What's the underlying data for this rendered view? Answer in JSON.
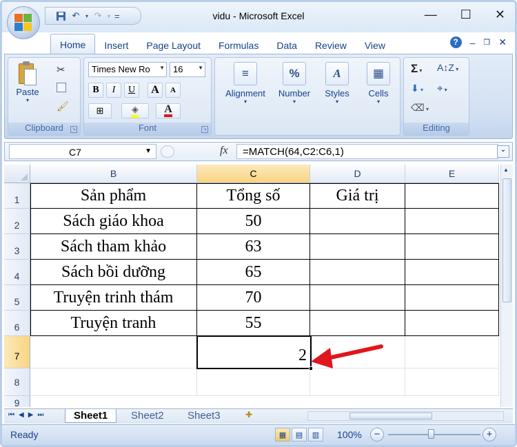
{
  "window": {
    "title": "vidu - Microsoft Excel",
    "minimize": "—",
    "maximize": "☐",
    "close": "✕"
  },
  "qat": {
    "save_icon": "save-icon",
    "undo_icon": "undo-icon",
    "redo_icon": "redo-icon",
    "customize": "="
  },
  "tabs": [
    "Home",
    "Insert",
    "Page Layout",
    "Formulas",
    "Data",
    "Review",
    "View"
  ],
  "active_tab": "Home",
  "ribbon": {
    "clipboard": {
      "label": "Clipboard",
      "paste": "Paste"
    },
    "font": {
      "label": "Font",
      "name": "Times New Ro",
      "size": "16",
      "bold": "B",
      "italic": "I",
      "underline": "U",
      "grow": "A",
      "shrink": "A",
      "color": "A"
    },
    "alignment": {
      "label": "Alignment"
    },
    "number": {
      "label": "Number",
      "icon": "%"
    },
    "styles": {
      "label": "Styles"
    },
    "cells": {
      "label": "Cells"
    },
    "editing": {
      "label": "Editing",
      "sum": "Σ"
    }
  },
  "formula_bar": {
    "name_box": "C7",
    "fx": "fx",
    "formula": "=MATCH(64,C2:C6,1)"
  },
  "grid": {
    "columns": [
      "B",
      "C",
      "D",
      "E"
    ],
    "rows": [
      "1",
      "2",
      "3",
      "4",
      "5",
      "6",
      "7",
      "8",
      "9"
    ],
    "selected_cell": "C7",
    "headers": [
      "Sản phẩm",
      "Tổng số",
      "Giá trị"
    ],
    "data": [
      {
        "product": "Sách giáo khoa",
        "total": "50"
      },
      {
        "product": "Sách tham khảo",
        "total": "63"
      },
      {
        "product": "Sách bồi dưỡng",
        "total": "65"
      },
      {
        "product": "Truyện trinh thám",
        "total": "70"
      },
      {
        "product": "Truyện tranh",
        "total": "55"
      }
    ],
    "result": "2"
  },
  "sheets": [
    "Sheet1",
    "Sheet2",
    "Sheet3"
  ],
  "active_sheet": "Sheet1",
  "status": {
    "text": "Ready",
    "zoom": "100%"
  },
  "colors": {
    "accent": "#15428b",
    "selection_header": "#f9d483",
    "annotation_arrow": "#e0161c"
  }
}
